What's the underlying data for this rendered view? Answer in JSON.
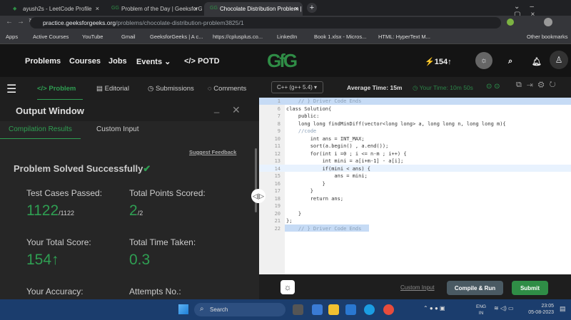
{
  "browser": {
    "tabs": [
      {
        "title": "ayush2s - LeetCode Profile"
      },
      {
        "title": "Problem of the Day | GeeksforGe"
      },
      {
        "title": "Chocolate Distribution Problem |",
        "active": true
      }
    ],
    "url_host": "practice.geeksforgeeks.org",
    "url_path": "/problems/chocolate-distribution-problem3825/1",
    "bookmarks": [
      "Apps",
      "Active Courses",
      "YouTube",
      "Gmail",
      "GeeksforGeeks | A c...",
      "https://cplusplus.co...",
      "LinkedIn",
      "Book 1.xlsx - Micros...",
      "HTML: HyperText M..."
    ],
    "other_bookmarks": "Other bookmarks"
  },
  "nav": {
    "items": [
      "Problems",
      "Courses",
      "Jobs",
      "Events",
      "POTD"
    ],
    "score": "154",
    "logo": "GfG"
  },
  "left": {
    "tabs": [
      "Problem",
      "Editorial",
      "Submissions",
      "Comments"
    ],
    "output_title": "Output Window",
    "subtabs": [
      "Compilation Results",
      "Custom Input"
    ],
    "suggest": "Suggest Feedback",
    "status": "Problem Solved Successfully",
    "stats": {
      "tc_label": "Test Cases Passed:",
      "tc_value": "1122",
      "tc_total": "/1122",
      "pts_label": "Total Points Scored:",
      "pts_value": "2",
      "pts_total": "/2",
      "score_label": "Your Total Score:",
      "score_value": "154",
      "time_label": "Total Time Taken:",
      "time_value": "0.3",
      "acc_label": "Your Accuracy:",
      "att_label": "Attempts No.:"
    }
  },
  "editor": {
    "language": "C++ (g++ 5.4)",
    "avg_time": "Average Time: 15m",
    "your_time": "Your Time: 10m 50s",
    "lines": [
      {
        "n": "1",
        "t": "    // } Driver Code Ends"
      },
      {
        "n": "6",
        "t": "class Solution{"
      },
      {
        "n": "7",
        "t": "    public:"
      },
      {
        "n": "8",
        "t": "    long long findMinDiff(vector<long long> a, long long n, long long m){"
      },
      {
        "n": "9",
        "t": "    //code"
      },
      {
        "n": "10",
        "t": "        int ans = INT_MAX;"
      },
      {
        "n": "11",
        "t": "        sort(a.begin() , a.end());"
      },
      {
        "n": "12",
        "t": "        for(int i =0 ; i <= n-m ; i++) {"
      },
      {
        "n": "13",
        "t": "            int mini = a[i+m-1] - a[i];"
      },
      {
        "n": "14",
        "t": "            if(mini < ans) {"
      },
      {
        "n": "15",
        "t": "                ans = mini;"
      },
      {
        "n": "16",
        "t": "            }"
      },
      {
        "n": "17",
        "t": "        }"
      },
      {
        "n": "18",
        "t": "        return ans;"
      },
      {
        "n": "19",
        "t": ""
      },
      {
        "n": "20",
        "t": "    }"
      },
      {
        "n": "21",
        "t": "};"
      },
      {
        "n": "22",
        "t": "    // } Driver Code Ends"
      }
    ],
    "custom_input": "Custom Input",
    "compile": "Compile & Run",
    "submit": "Submit"
  },
  "taskbar": {
    "search": "Search",
    "lang1": "ENG",
    "lang2": "IN",
    "time": "23:05",
    "date": "05-08-2023"
  }
}
